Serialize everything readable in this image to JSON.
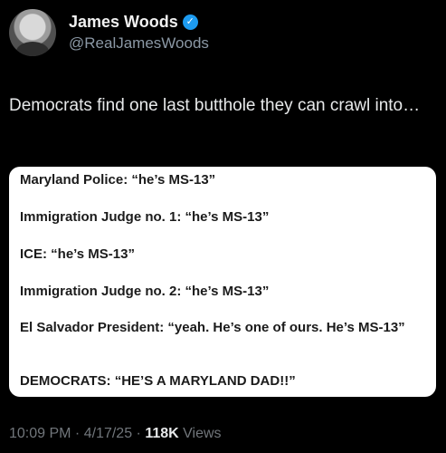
{
  "author": {
    "display_name": "James Woods",
    "handle": "@RealJamesWoods",
    "verified_icon": "verified-badge-icon",
    "verified_color": "#1d9bf0"
  },
  "tweet": {
    "text": "Democrats find one last butthole they can crawl into…"
  },
  "quoted_image": {
    "lines": [
      "Maryland Police: “he’s MS-13”",
      "Immigration Judge no. 1:  “he’s MS-13”",
      "ICE:  “he’s MS-13”",
      "Immigration Judge no. 2:  “he’s MS-13”",
      "El Salvador President: “yeah. He’s one of ours. He’s MS-13”",
      "DEMOCRATS:  “HE’S A MARYLAND DAD!!”"
    ]
  },
  "meta": {
    "time": "10:09 PM",
    "date": "4/17/25",
    "separator": " · ",
    "views_count": "118K",
    "views_label": "Views"
  }
}
